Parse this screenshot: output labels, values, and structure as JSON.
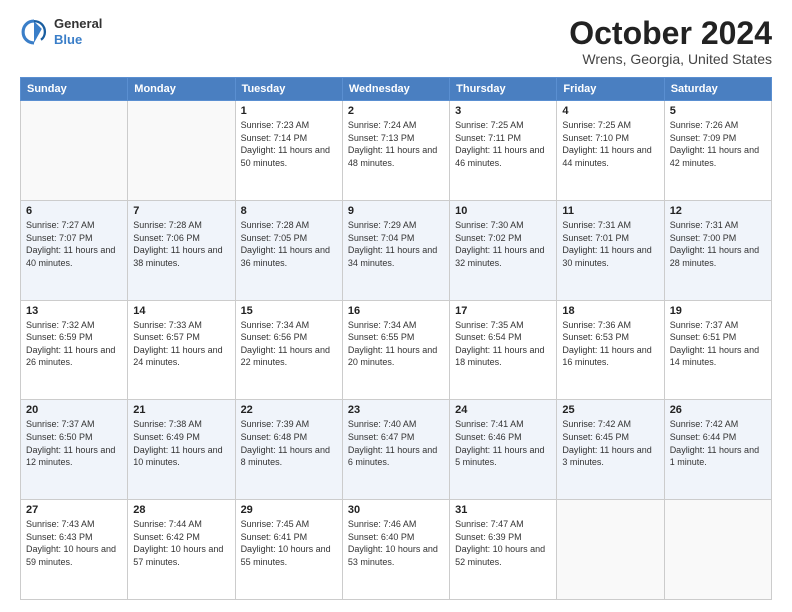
{
  "header": {
    "logo": {
      "line1": "General",
      "line2": "Blue"
    },
    "title": "October 2024",
    "subtitle": "Wrens, Georgia, United States"
  },
  "columns": [
    "Sunday",
    "Monday",
    "Tuesday",
    "Wednesday",
    "Thursday",
    "Friday",
    "Saturday"
  ],
  "weeks": [
    [
      {
        "day": "",
        "detail": ""
      },
      {
        "day": "",
        "detail": ""
      },
      {
        "day": "1",
        "detail": "Sunrise: 7:23 AM\nSunset: 7:14 PM\nDaylight: 11 hours and 50 minutes."
      },
      {
        "day": "2",
        "detail": "Sunrise: 7:24 AM\nSunset: 7:13 PM\nDaylight: 11 hours and 48 minutes."
      },
      {
        "day": "3",
        "detail": "Sunrise: 7:25 AM\nSunset: 7:11 PM\nDaylight: 11 hours and 46 minutes."
      },
      {
        "day": "4",
        "detail": "Sunrise: 7:25 AM\nSunset: 7:10 PM\nDaylight: 11 hours and 44 minutes."
      },
      {
        "day": "5",
        "detail": "Sunrise: 7:26 AM\nSunset: 7:09 PM\nDaylight: 11 hours and 42 minutes."
      }
    ],
    [
      {
        "day": "6",
        "detail": "Sunrise: 7:27 AM\nSunset: 7:07 PM\nDaylight: 11 hours and 40 minutes."
      },
      {
        "day": "7",
        "detail": "Sunrise: 7:28 AM\nSunset: 7:06 PM\nDaylight: 11 hours and 38 minutes."
      },
      {
        "day": "8",
        "detail": "Sunrise: 7:28 AM\nSunset: 7:05 PM\nDaylight: 11 hours and 36 minutes."
      },
      {
        "day": "9",
        "detail": "Sunrise: 7:29 AM\nSunset: 7:04 PM\nDaylight: 11 hours and 34 minutes."
      },
      {
        "day": "10",
        "detail": "Sunrise: 7:30 AM\nSunset: 7:02 PM\nDaylight: 11 hours and 32 minutes."
      },
      {
        "day": "11",
        "detail": "Sunrise: 7:31 AM\nSunset: 7:01 PM\nDaylight: 11 hours and 30 minutes."
      },
      {
        "day": "12",
        "detail": "Sunrise: 7:31 AM\nSunset: 7:00 PM\nDaylight: 11 hours and 28 minutes."
      }
    ],
    [
      {
        "day": "13",
        "detail": "Sunrise: 7:32 AM\nSunset: 6:59 PM\nDaylight: 11 hours and 26 minutes."
      },
      {
        "day": "14",
        "detail": "Sunrise: 7:33 AM\nSunset: 6:57 PM\nDaylight: 11 hours and 24 minutes."
      },
      {
        "day": "15",
        "detail": "Sunrise: 7:34 AM\nSunset: 6:56 PM\nDaylight: 11 hours and 22 minutes."
      },
      {
        "day": "16",
        "detail": "Sunrise: 7:34 AM\nSunset: 6:55 PM\nDaylight: 11 hours and 20 minutes."
      },
      {
        "day": "17",
        "detail": "Sunrise: 7:35 AM\nSunset: 6:54 PM\nDaylight: 11 hours and 18 minutes."
      },
      {
        "day": "18",
        "detail": "Sunrise: 7:36 AM\nSunset: 6:53 PM\nDaylight: 11 hours and 16 minutes."
      },
      {
        "day": "19",
        "detail": "Sunrise: 7:37 AM\nSunset: 6:51 PM\nDaylight: 11 hours and 14 minutes."
      }
    ],
    [
      {
        "day": "20",
        "detail": "Sunrise: 7:37 AM\nSunset: 6:50 PM\nDaylight: 11 hours and 12 minutes."
      },
      {
        "day": "21",
        "detail": "Sunrise: 7:38 AM\nSunset: 6:49 PM\nDaylight: 11 hours and 10 minutes."
      },
      {
        "day": "22",
        "detail": "Sunrise: 7:39 AM\nSunset: 6:48 PM\nDaylight: 11 hours and 8 minutes."
      },
      {
        "day": "23",
        "detail": "Sunrise: 7:40 AM\nSunset: 6:47 PM\nDaylight: 11 hours and 6 minutes."
      },
      {
        "day": "24",
        "detail": "Sunrise: 7:41 AM\nSunset: 6:46 PM\nDaylight: 11 hours and 5 minutes."
      },
      {
        "day": "25",
        "detail": "Sunrise: 7:42 AM\nSunset: 6:45 PM\nDaylight: 11 hours and 3 minutes."
      },
      {
        "day": "26",
        "detail": "Sunrise: 7:42 AM\nSunset: 6:44 PM\nDaylight: 11 hours and 1 minute."
      }
    ],
    [
      {
        "day": "27",
        "detail": "Sunrise: 7:43 AM\nSunset: 6:43 PM\nDaylight: 10 hours and 59 minutes."
      },
      {
        "day": "28",
        "detail": "Sunrise: 7:44 AM\nSunset: 6:42 PM\nDaylight: 10 hours and 57 minutes."
      },
      {
        "day": "29",
        "detail": "Sunrise: 7:45 AM\nSunset: 6:41 PM\nDaylight: 10 hours and 55 minutes."
      },
      {
        "day": "30",
        "detail": "Sunrise: 7:46 AM\nSunset: 6:40 PM\nDaylight: 10 hours and 53 minutes."
      },
      {
        "day": "31",
        "detail": "Sunrise: 7:47 AM\nSunset: 6:39 PM\nDaylight: 10 hours and 52 minutes."
      },
      {
        "day": "",
        "detail": ""
      },
      {
        "day": "",
        "detail": ""
      }
    ]
  ]
}
